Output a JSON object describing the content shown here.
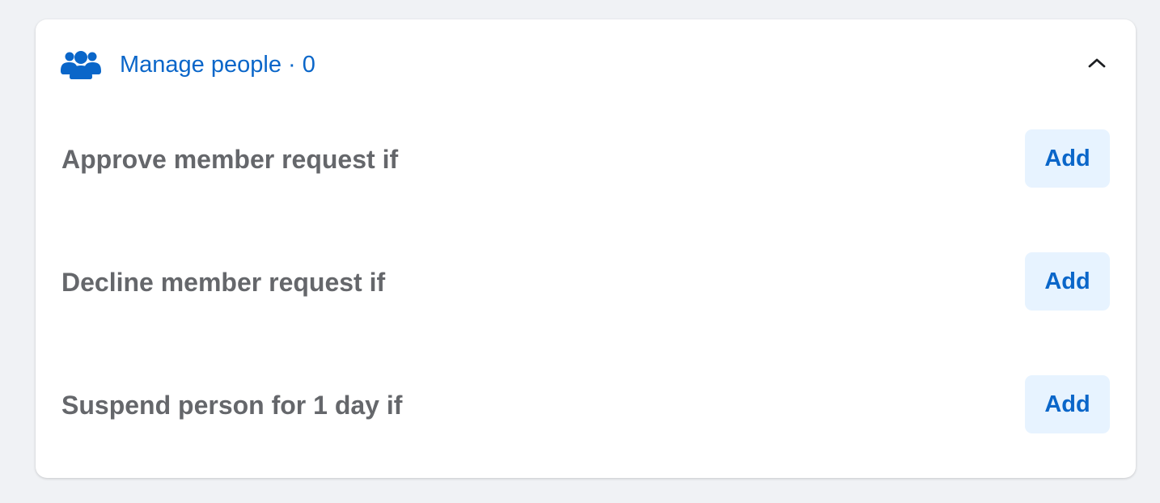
{
  "section": {
    "title": "Manage people",
    "separator": "·",
    "count": "0",
    "icon": "people-group-icon",
    "collapse_icon": "chevron-up-icon",
    "accent_color": "#0a66c9"
  },
  "rules": [
    {
      "label": "Approve member request if",
      "button": "Add"
    },
    {
      "label": "Decline member request if",
      "button": "Add"
    },
    {
      "label": "Suspend person for 1 day if",
      "button": "Add"
    }
  ]
}
